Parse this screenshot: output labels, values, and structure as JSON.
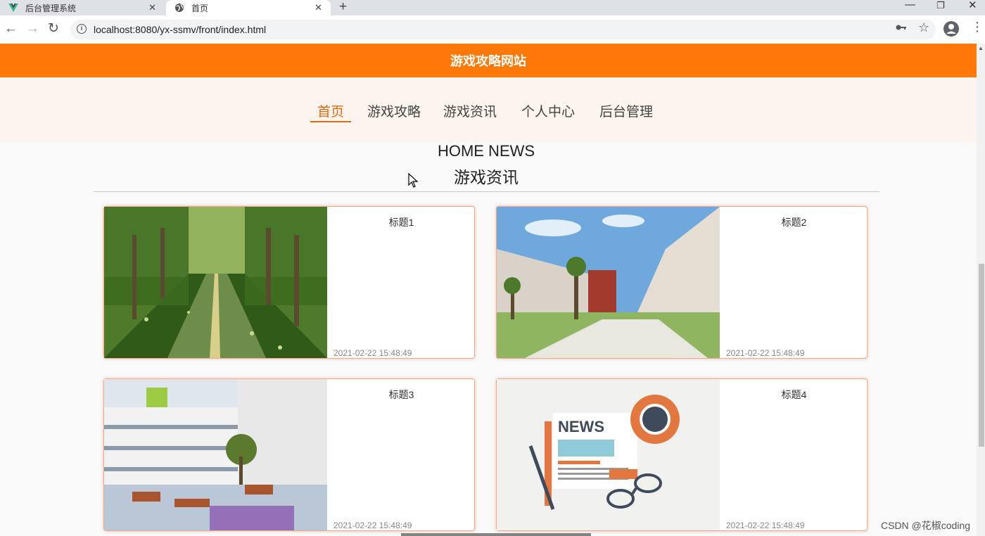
{
  "browser": {
    "tabs": [
      {
        "title": "后台管理系统",
        "favicon": "vue-logo-icon",
        "active": false
      },
      {
        "title": "首页",
        "favicon": "globe-icon",
        "active": true
      }
    ],
    "url": "localhost:8080/yx-ssmv/front/index.html"
  },
  "site": {
    "title": "游戏攻略网站",
    "accent_color": "#ff7908"
  },
  "nav": {
    "items": [
      "首页",
      "游戏攻略",
      "游戏资讯",
      "个人中心",
      "后台管理"
    ],
    "active_index": 0
  },
  "section": {
    "title_en": "HOME NEWS",
    "title_cn": "游戏资讯"
  },
  "news": [
    {
      "title": "标题1",
      "time": "2021-02-22 15:48:49"
    },
    {
      "title": "标题2",
      "time": "2021-02-22 15:48:49"
    },
    {
      "title": "标题3",
      "time": "2021-02-22 15:48:49"
    },
    {
      "title": "标题4",
      "time": "2021-02-22 15:48:49"
    }
  ],
  "watermark": "CSDN @花椒coding"
}
